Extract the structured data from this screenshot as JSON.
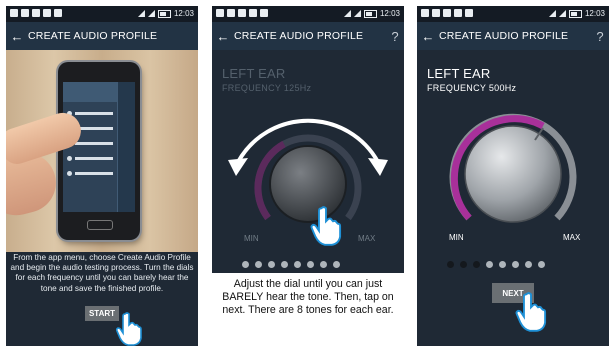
{
  "status_bar": {
    "time": "12:03"
  },
  "app_bar": {
    "back_glyph": "←",
    "title": "CREATE AUDIO PROFILE",
    "help_glyph": "?"
  },
  "panel1": {
    "description": "From the app menu, choose Create Audio Profile and begin the audio testing process. Turn the dials for each frequency until you can barely hear the tone and save the finished profile.",
    "start_button": "START"
  },
  "panel2": {
    "ear": "LEFT EAR",
    "frequency": "FREQUENCY 125Hz",
    "min_label": "MIN",
    "max_label": "MAX",
    "dial_level": 0.0,
    "dots_total": 8,
    "dots_active": 0,
    "caption": "Adjust the dial until you can just BARELY hear the tone. Then, tap on next. There are 8 tones for each ear."
  },
  "panel3": {
    "ear": "LEFT EAR",
    "frequency": "FREQUENCY 500Hz",
    "min_label": "MIN",
    "max_label": "MAX",
    "dial_level": 0.55,
    "dots_total": 8,
    "dots_active": 3,
    "next_button": "NEXT"
  },
  "colors": {
    "background": "#1f2935",
    "app_bar": "#223344",
    "accent_arc": "#a8309a",
    "dot_active": "#14181d",
    "dot_inactive": "#aeb5bb",
    "button": "#6a6f73"
  },
  "icons": [
    "back-arrow-icon",
    "help-icon",
    "tap-hand-icon",
    "rotate-arrows-icon"
  ]
}
